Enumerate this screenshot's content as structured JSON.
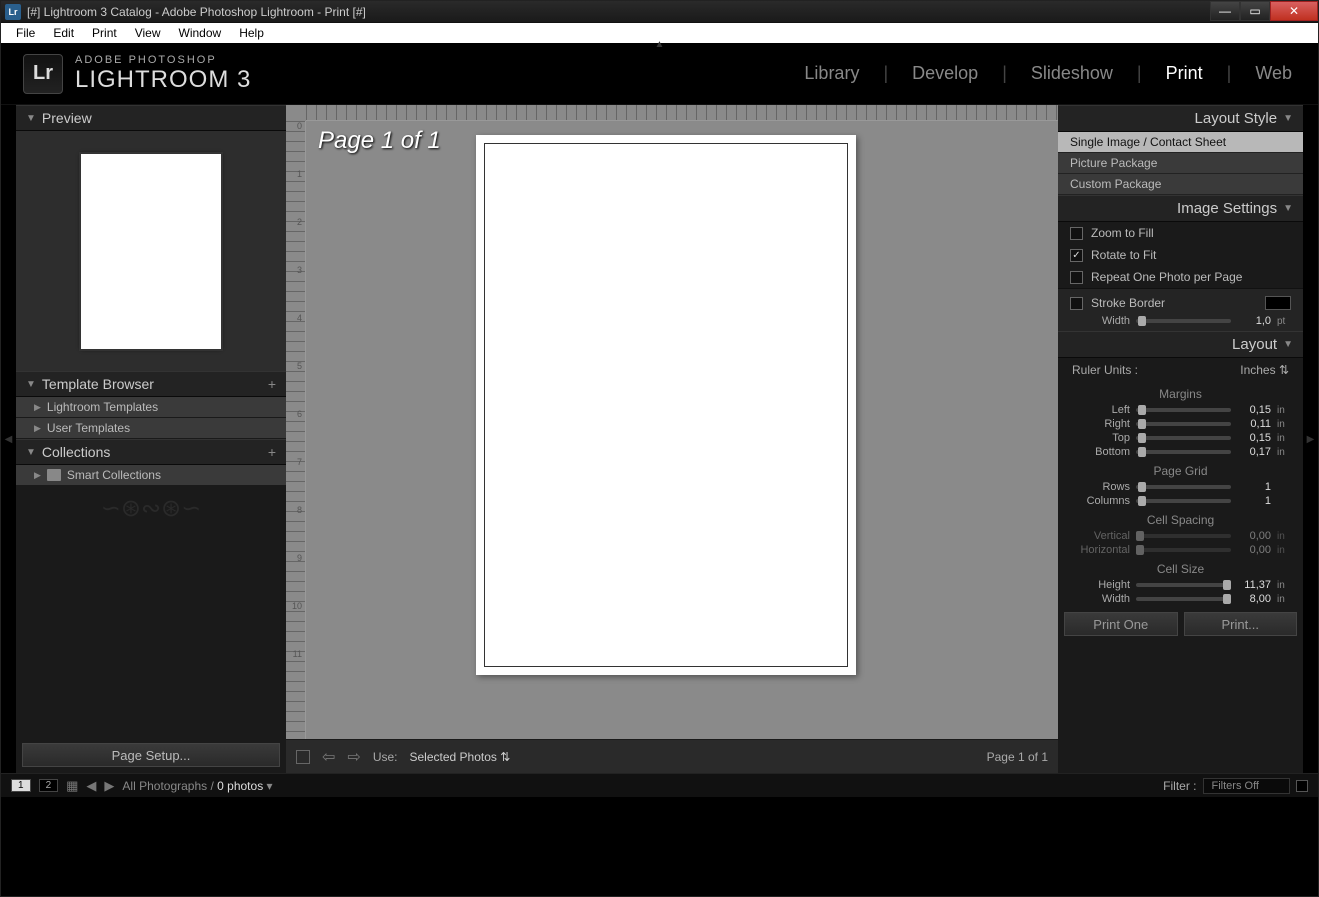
{
  "title": "[#] Lightroom 3 Catalog - Adobe Photoshop Lightroom - Print [#]",
  "menu": [
    "File",
    "Edit",
    "Print",
    "View",
    "Window",
    "Help"
  ],
  "brand": {
    "small": "ADOBE PHOTOSHOP",
    "product": "LIGHTROOM 3",
    "logo": "Lr"
  },
  "modules": [
    "Library",
    "Develop",
    "Slideshow",
    "Print",
    "Web"
  ],
  "modules_active": "Print",
  "left": {
    "preview": "Preview",
    "template_browser": "Template Browser",
    "templates": [
      "Lightroom Templates",
      "User Templates"
    ],
    "collections": "Collections",
    "smart": "Smart Collections",
    "page_setup": "Page Setup..."
  },
  "center": {
    "page_label": "Page 1 of 1",
    "use_label": "Use:",
    "use_value": "Selected Photos",
    "page_info": "Page 1 of 1",
    "ruler_marks": [
      "0",
      "1",
      "2",
      "3",
      "4",
      "5",
      "6",
      "7",
      "8",
      "9",
      "10",
      "11"
    ]
  },
  "right": {
    "layout_style": "Layout Style",
    "styles": [
      "Single Image / Contact Sheet",
      "Picture Package",
      "Custom Package"
    ],
    "image_settings": "Image Settings",
    "zoom_fill": "Zoom to Fill",
    "rotate_fit": "Rotate to Fit",
    "repeat": "Repeat One Photo per Page",
    "stroke_border": "Stroke Border",
    "stroke_width_label": "Width",
    "stroke_width_val": "1,0",
    "stroke_unit": "pt",
    "layout": "Layout",
    "ruler_units_label": "Ruler Units :",
    "ruler_units_value": "Inches",
    "margins": "Margins",
    "margin_rows": [
      {
        "label": "Left",
        "val": "0,15",
        "unit": "in",
        "pos": 2
      },
      {
        "label": "Right",
        "val": "0,11",
        "unit": "in",
        "pos": 2
      },
      {
        "label": "Top",
        "val": "0,15",
        "unit": "in",
        "pos": 2
      },
      {
        "label": "Bottom",
        "val": "0,17",
        "unit": "in",
        "pos": 2
      }
    ],
    "page_grid": "Page Grid",
    "grid_rows": [
      {
        "label": "Rows",
        "val": "1",
        "unit": "",
        "pos": 2
      },
      {
        "label": "Columns",
        "val": "1",
        "unit": "",
        "pos": 2
      }
    ],
    "cell_spacing": "Cell Spacing",
    "spacing_rows": [
      {
        "label": "Vertical",
        "val": "0,00",
        "unit": "in",
        "pos": 0
      },
      {
        "label": "Horizontal",
        "val": "0,00",
        "unit": "in",
        "pos": 0
      }
    ],
    "cell_size": "Cell Size",
    "size_rows": [
      {
        "label": "Height",
        "val": "11,37",
        "unit": "in",
        "pos": 92
      },
      {
        "label": "Width",
        "val": "8,00",
        "unit": "in",
        "pos": 92
      }
    ],
    "print_one": "Print One",
    "print": "Print..."
  },
  "filmstrip": {
    "crumb_a": "All Photographs /",
    "crumb_b": "0 photos",
    "filter_label": "Filter :",
    "filter_value": "Filters Off"
  }
}
